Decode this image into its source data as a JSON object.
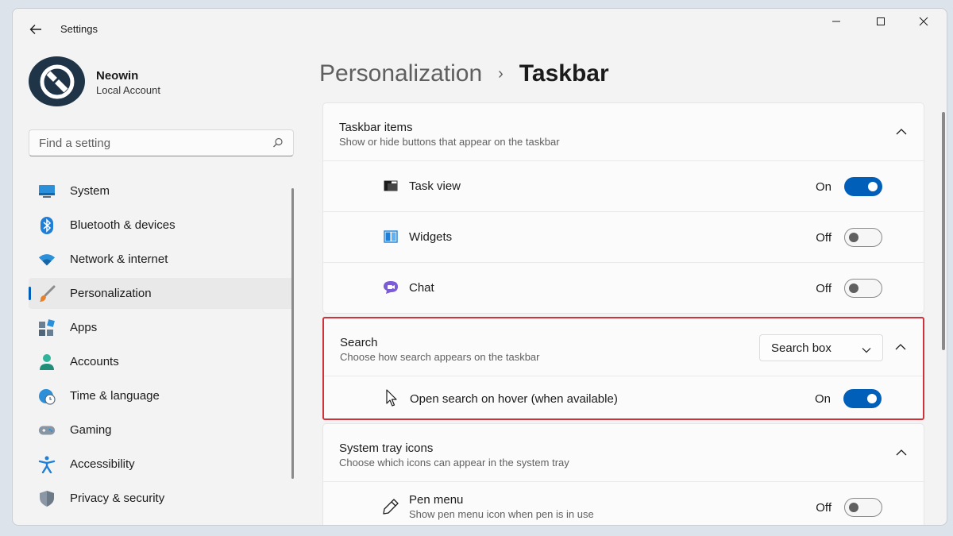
{
  "window": {
    "app_title": "Settings"
  },
  "user": {
    "name": "Neowin",
    "account_type": "Local Account"
  },
  "search": {
    "placeholder": "Find a setting"
  },
  "sidebar": {
    "items": [
      {
        "label": "System",
        "icon": "monitor-icon",
        "active": false
      },
      {
        "label": "Bluetooth & devices",
        "icon": "bluetooth-icon",
        "active": false
      },
      {
        "label": "Network & internet",
        "icon": "wifi-icon",
        "active": false
      },
      {
        "label": "Personalization",
        "icon": "paintbrush-icon",
        "active": true
      },
      {
        "label": "Apps",
        "icon": "apps-icon",
        "active": false
      },
      {
        "label": "Accounts",
        "icon": "person-icon",
        "active": false
      },
      {
        "label": "Time & language",
        "icon": "globe-clock-icon",
        "active": false
      },
      {
        "label": "Gaming",
        "icon": "gamepad-icon",
        "active": false
      },
      {
        "label": "Accessibility",
        "icon": "accessibility-icon",
        "active": false
      },
      {
        "label": "Privacy & security",
        "icon": "shield-icon",
        "active": false
      }
    ]
  },
  "breadcrumb": {
    "parent": "Personalization",
    "separator": "›",
    "current": "Taskbar"
  },
  "taskbar_items": {
    "title": "Taskbar items",
    "description": "Show or hide buttons that appear on the taskbar",
    "items": [
      {
        "label": "Task view",
        "state": "On",
        "on": true,
        "icon": "task-view-icon"
      },
      {
        "label": "Widgets",
        "state": "Off",
        "on": false,
        "icon": "widgets-icon"
      },
      {
        "label": "Chat",
        "state": "Off",
        "on": false,
        "icon": "chat-icon"
      }
    ]
  },
  "search_section": {
    "title": "Search",
    "description": "Choose how search appears on the taskbar",
    "dropdown_value": "Search box",
    "hover": {
      "label": "Open search on hover (when available)",
      "state": "On",
      "on": true,
      "icon": "cursor-icon"
    }
  },
  "system_tray": {
    "title": "System tray icons",
    "description": "Choose which icons can appear in the system tray",
    "pen_menu": {
      "label": "Pen menu",
      "description": "Show pen menu icon when pen is in use",
      "state": "Off",
      "on": false,
      "icon": "pen-icon"
    }
  },
  "colors": {
    "accent": "#005fb8",
    "highlight": "#d0323b"
  }
}
